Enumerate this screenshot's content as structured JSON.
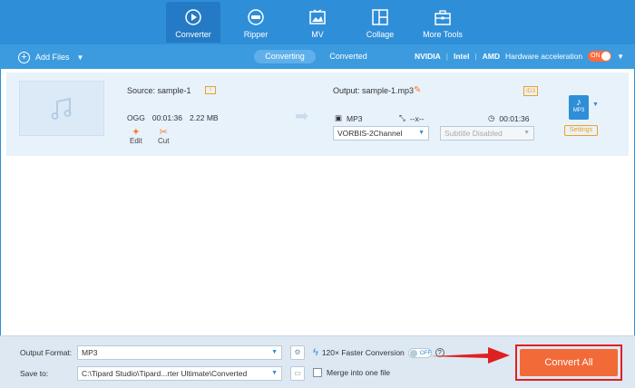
{
  "nav": {
    "tabs": [
      {
        "label": "Converter",
        "icon": "converter-icon"
      },
      {
        "label": "Ripper",
        "icon": "ripper-icon"
      },
      {
        "label": "MV",
        "icon": "mv-icon"
      },
      {
        "label": "Collage",
        "icon": "collage-icon"
      },
      {
        "label": "More Tools",
        "icon": "toolbox-icon"
      }
    ],
    "active": "Converter"
  },
  "toolbar": {
    "add_files": "Add Files",
    "tabs": [
      "Converting",
      "Converted"
    ],
    "active_tab": "Converting",
    "hw": {
      "nvidia": "NVIDIA",
      "intel": "Intel",
      "amd": "AMD",
      "label": "Hardware acceleration",
      "toggle": "ON"
    }
  },
  "file": {
    "source": "Source: sample-1",
    "format": "OGG",
    "duration": "00:01:36",
    "size": "2.22 MB",
    "edit": "Edit",
    "cut": "Cut",
    "output": "Output: sample-1.mp3",
    "id3": "ID3",
    "out_format": "MP3",
    "resolution": "--x--",
    "out_duration": "00:01:36",
    "audio_channel": "VORBIS-2Channel",
    "subtitle": "Subtitle Disabled",
    "format_badge": "MP3",
    "settings": "Settings"
  },
  "bottom": {
    "output_format_label": "Output Format:",
    "output_format_value": "MP3",
    "save_to_label": "Save to:",
    "save_to_value": "C:\\Tipard Studio\\Tipard...rter Ultimate\\Converted",
    "faster": "120× Faster Conversion",
    "faster_toggle": "OFF",
    "help": "?",
    "merge": "Merge into one file",
    "convert_all": "Convert All"
  },
  "colors": {
    "nav_bg": "#2f8ed8",
    "accent": "#f26a38",
    "highlight": "#e02020"
  }
}
